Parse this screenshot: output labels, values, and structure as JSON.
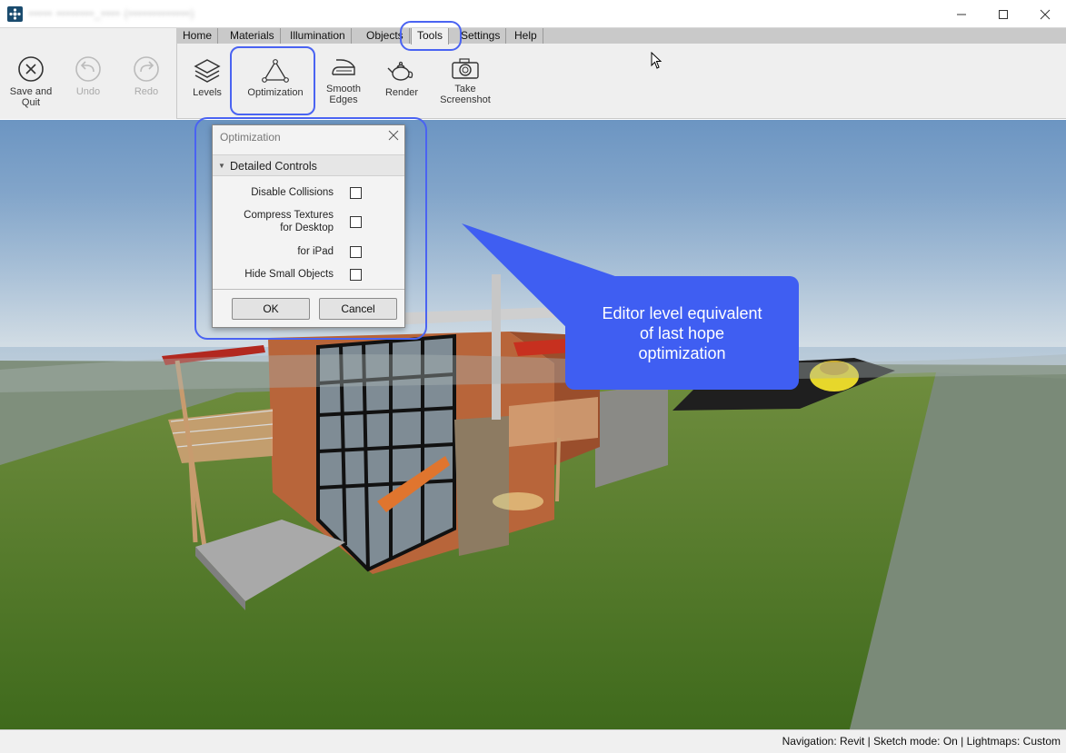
{
  "window": {
    "title": "••••• ••••••••_•••• (•••••••••••••)",
    "app_icon": "app-logo-icon"
  },
  "ribbon": {
    "left_buttons": [
      {
        "label_line1": "Save and",
        "label_line2": "Quit",
        "icon": "close-circle-icon",
        "enabled": true
      },
      {
        "label_line1": "Undo",
        "label_line2": "",
        "icon": "undo-icon",
        "enabled": false
      },
      {
        "label_line1": "Redo",
        "label_line2": "",
        "icon": "redo-icon",
        "enabled": false
      }
    ],
    "tabs": [
      "Home",
      "Materials",
      "Illumination",
      "Objects",
      "Tools",
      "Settings",
      "Help"
    ],
    "active_tab": "Tools",
    "tool_buttons": [
      {
        "label_line1": "Levels",
        "label_line2": "",
        "icon": "layers-icon"
      },
      {
        "label_line1": "Optimization",
        "label_line2": "",
        "icon": "triangle-mesh-icon"
      },
      {
        "label_line1": "Smooth",
        "label_line2": "Edges",
        "icon": "iron-icon"
      },
      {
        "label_line1": "Render",
        "label_line2": "",
        "icon": "teapot-icon"
      },
      {
        "label_line1": "Take",
        "label_line2": "Screenshot",
        "icon": "camera-icon"
      }
    ]
  },
  "dialog": {
    "title": "Optimization",
    "section": "Detailed Controls",
    "options": [
      {
        "label_line1": "Disable Collisions",
        "label_line2": "",
        "checked": false
      },
      {
        "label_line1": "Compress Textures",
        "label_line2": "for Desktop",
        "checked": false
      },
      {
        "label_line1": "for iPad",
        "label_line2": "",
        "checked": false
      },
      {
        "label_line1": "Hide Small Objects",
        "label_line2": "",
        "checked": false
      }
    ],
    "ok_label": "OK",
    "cancel_label": "Cancel"
  },
  "callout": {
    "line1": "Editor level equivalent",
    "line2": "of last hope",
    "line3": "optimization",
    "color": "#3f5ef2"
  },
  "highlight_color": "#4a63f2",
  "statusbar": {
    "text": "Navigation: Revit  |  Sketch mode: On  |  Lightmaps: Custom"
  }
}
